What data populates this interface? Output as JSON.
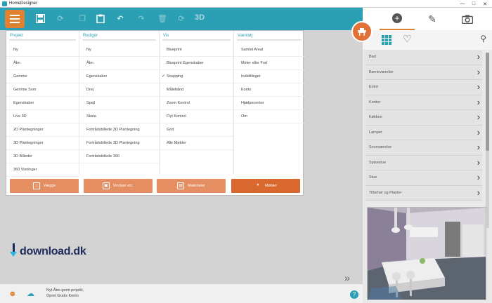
{
  "window": {
    "title": "HomeDesigner"
  },
  "toolbar": {
    "three_d_label": "3D"
  },
  "menu": {
    "columns": [
      {
        "header": "Projekt",
        "items": [
          {
            "label": "Ny"
          },
          {
            "label": "Åbn"
          },
          {
            "label": "Gemme"
          },
          {
            "label": "Gemme Som"
          },
          {
            "label": "Egenskaber"
          },
          {
            "label": "Live 3D"
          },
          {
            "label": "2D Plantegninger"
          },
          {
            "label": "3D Plantegninger"
          },
          {
            "label": "3D Billeder"
          },
          {
            "label": "360 Visninger"
          }
        ]
      },
      {
        "header": "Redigér",
        "items": [
          {
            "label": "Ny"
          },
          {
            "label": "Åbn"
          },
          {
            "label": "Egenskaber"
          },
          {
            "label": "Drej"
          },
          {
            "label": "Spejl"
          },
          {
            "label": "Skala"
          },
          {
            "label": "Fortrådsbillede 3D Plantegning"
          },
          {
            "label": "Fortrådsbillede 3D Plantegning"
          },
          {
            "label": "Fortrådsbillede 360"
          }
        ]
      },
      {
        "header": "Vis",
        "items": [
          {
            "label": "Blueprint"
          },
          {
            "label": "Blueprint Egenskaber"
          },
          {
            "label": "Snapping",
            "checked": true
          },
          {
            "label": "Målebånd"
          },
          {
            "label": "Zoom Kontrol"
          },
          {
            "label": "Flyt Kontrol"
          },
          {
            "label": "Grid"
          },
          {
            "label": "Alle Møbler"
          }
        ]
      },
      {
        "header": "Værktøj",
        "items": [
          {
            "label": "Samlet Areal"
          },
          {
            "label": "Meter eller Fod"
          },
          {
            "label": "Indstillinger"
          },
          {
            "label": "Konto"
          },
          {
            "label": "Hjælpecenter"
          },
          {
            "label": "Om"
          }
        ]
      }
    ],
    "check_mark": "✓",
    "categories": [
      {
        "label": "Vægge",
        "icon": "wall-icon"
      },
      {
        "label": "Vinduer etc.",
        "icon": "window-icon"
      },
      {
        "label": "Materialer",
        "icon": "paint-roller-icon"
      },
      {
        "label": "Møbler",
        "icon": "furniture-icon",
        "active": true
      }
    ]
  },
  "logo": {
    "text": "download.dk"
  },
  "right_panel": {
    "categories": [
      {
        "label": "Bad"
      },
      {
        "label": "Børneværelse"
      },
      {
        "label": "Entré"
      },
      {
        "label": "Kontor"
      },
      {
        "label": "Køkken"
      },
      {
        "label": "Lamper"
      },
      {
        "label": "Soveværelse"
      },
      {
        "label": "Spisestue"
      },
      {
        "label": "Stue"
      },
      {
        "label": "Tilbehør og Planter"
      }
    ]
  },
  "statusbar": {
    "line1": "Nyt Åbn-gemt projekt,",
    "line2": "Opret Gratis Konto",
    "help": "?"
  },
  "colors": {
    "accent": "#2b9fb3",
    "orange": "#e0822f",
    "category_button": "#e58e62",
    "category_active": "#d9682e"
  }
}
